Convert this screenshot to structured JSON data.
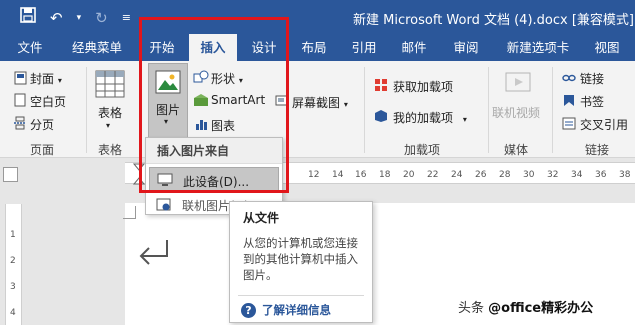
{
  "title_bar": {
    "save_icon": "save-icon",
    "undo_icon": "undo-icon",
    "redo_icon": "redo-icon",
    "customize_icon": "qat-dropdown-icon",
    "document_title": "新建 Microsoft Word 文档 (4).docx [兼容模式] -"
  },
  "tabs": [
    {
      "label": "文件",
      "active": false
    },
    {
      "label": "经典菜单",
      "active": false
    },
    {
      "label": "开始",
      "active": false
    },
    {
      "label": "插入",
      "active": true
    },
    {
      "label": "设计",
      "active": false
    },
    {
      "label": "布局",
      "active": false
    },
    {
      "label": "引用",
      "active": false
    },
    {
      "label": "邮件",
      "active": false
    },
    {
      "label": "审阅",
      "active": false
    },
    {
      "label": "新建选项卡",
      "active": false
    },
    {
      "label": "视图",
      "active": false
    }
  ],
  "ribbon": {
    "pages": {
      "cover": "封面",
      "blank": "空白页",
      "break": "分页",
      "group": "页面"
    },
    "tables": {
      "table": "表格",
      "group": "表格"
    },
    "illustrations": {
      "pictures": "图片",
      "shapes": "形状",
      "smartart": "SmartArt",
      "chart": "图表",
      "screenshot": "屏幕截图"
    },
    "addins": {
      "get": "获取加载项",
      "my": "我的加载项",
      "group": "加载项"
    },
    "media": {
      "online_video": "联机视频",
      "group": "媒体"
    },
    "links": {
      "link": "链接",
      "bookmark": "书签",
      "cross_ref": "交叉引用",
      "group": "链接"
    }
  },
  "ruler": {
    "h_numbers": [
      "12",
      "14",
      "16",
      "18",
      "20",
      "22",
      "24",
      "26",
      "28",
      "30",
      "32",
      "34",
      "36",
      "38"
    ],
    "v_numbers": [
      "1",
      "2",
      "3",
      "4"
    ]
  },
  "dropdown": {
    "header": "插入图片来自",
    "item1": "此设备(D)...",
    "item2": "联机图片(O)..."
  },
  "tooltip": {
    "title": "从文件",
    "desc": "从您的计算机或您连接到的其他计算机中插入图片。",
    "help": "了解详细信息"
  },
  "watermark": {
    "prefix": "头条 ",
    "handle": "@office精彩办公"
  },
  "colors": {
    "accent": "#2b579a",
    "highlight_border": "#e1161b"
  }
}
